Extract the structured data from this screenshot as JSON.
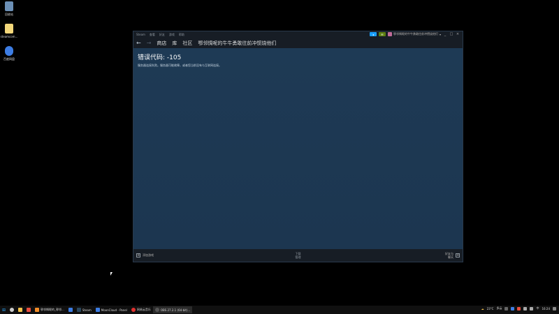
{
  "desktop": {
    "icons": [
      {
        "label": "回收站",
        "icon": "recycle-bin-icon",
        "color": "#6b8fb5"
      },
      {
        "label": "steamcom...",
        "icon": "file-icon",
        "color": "#f3d77a"
      },
      {
        "label": "百度网盘",
        "icon": "cloud-icon",
        "color": "#3d7de4"
      }
    ]
  },
  "steam": {
    "menu": [
      "Steam",
      "查看",
      "好友",
      "游戏",
      "帮助"
    ],
    "account_name": "鄂邻惆呢的牛牛勇敢往前冲惯烧他们",
    "window_controls": [
      "_",
      "□",
      "×"
    ],
    "nav": {
      "back": "←",
      "forward": "→",
      "store": "商店",
      "library": "库",
      "community": "社区",
      "profile_name": "鄂邻惆呢的牛牛勇敢往前冲惯烧他们"
    },
    "error": {
      "title": "错误代码: -105",
      "message": "服务器连接失败。服务器可能故障，或者您当前没有与互联网连接。"
    },
    "bottom": {
      "add_game": "添加游戏",
      "downloads_line1": "下载",
      "downloads_line2": "管理",
      "friends_line1": "好友与",
      "friends_line2": "聊天"
    },
    "colors": {
      "accent_blue": "#1a9fff",
      "accent_green": "#5c7e10"
    }
  },
  "taskbar": {
    "items": [
      {
        "label": "⊞",
        "icon": "windows-start-icon",
        "color": "#2aa0f0",
        "active": false
      },
      {
        "label": "",
        "icon": "search-icon",
        "color": "#cccccc",
        "active": false
      },
      {
        "label": "",
        "icon": "file-explorer-icon",
        "color": "#f3c24a",
        "active": false
      },
      {
        "label": "",
        "icon": "app-icon",
        "color": "#e84c3d",
        "active": false
      },
      {
        "label": "鄂邻惆呢的_鄂邻...",
        "icon": "app-icon",
        "color": "#f28c28",
        "active": false
      },
      {
        "label": "",
        "icon": "app-icon",
        "color": "#3d7de4",
        "active": false
      },
      {
        "label": "Steam",
        "icon": "steam-icon",
        "color": "#1b2838",
        "active": false
      },
      {
        "label": "MoonCloud - Panel",
        "icon": "app-icon",
        "color": "#3d7de4",
        "active": false
      },
      {
        "label": "网易云音乐",
        "icon": "music-icon",
        "color": "#e0312f",
        "active": false
      },
      {
        "label": "OBS 27.2.1 (64-bit)...",
        "icon": "obs-icon",
        "color": "#333333",
        "active": true
      }
    ],
    "tray": {
      "temperature": "23°C",
      "weather": "多云",
      "ime": "中",
      "time": "16:24"
    }
  }
}
